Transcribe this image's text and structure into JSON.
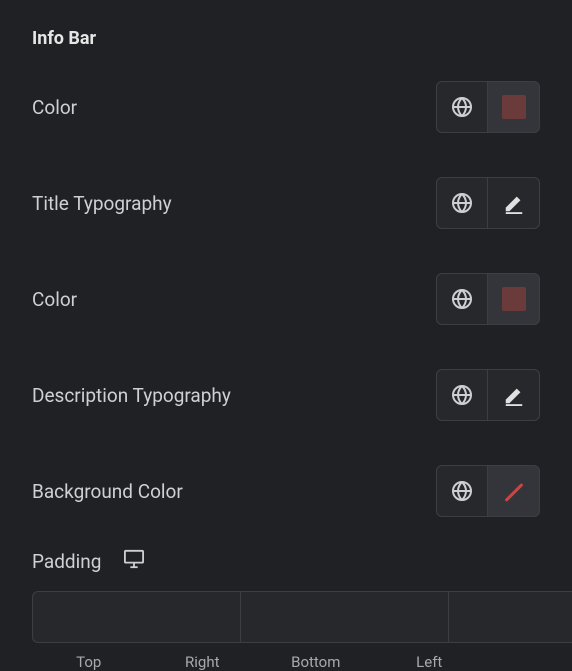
{
  "section_title": "Info Bar",
  "rows": {
    "color1": {
      "label": "Color",
      "swatch": "#6b3a3a"
    },
    "title_typo": {
      "label": "Title Typography"
    },
    "color2": {
      "label": "Color",
      "swatch": "#6b3a3a"
    },
    "desc_typo": {
      "label": "Description Typography"
    },
    "bg_color": {
      "label": "Background Color"
    }
  },
  "padding": {
    "label": "Padding",
    "sides": {
      "top": "Top",
      "right": "Right",
      "bottom": "Bottom",
      "left": "Left"
    },
    "values": {
      "top": "",
      "right": "",
      "bottom": "",
      "left": ""
    }
  }
}
